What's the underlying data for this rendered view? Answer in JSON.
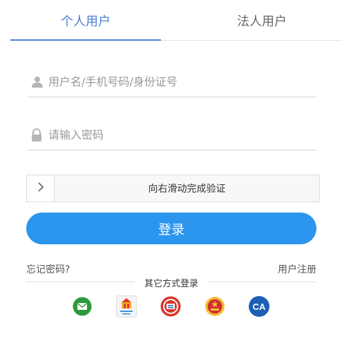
{
  "tabs": [
    {
      "label": "个人用户",
      "active": true
    },
    {
      "label": "法人用户",
      "active": false
    }
  ],
  "form": {
    "username_placeholder": "用户名/手机号码/身份证号",
    "password_placeholder": "请输入密码",
    "slider_text": "向右滑动完成验证",
    "login_label": "登录"
  },
  "links": {
    "forgot": "忘记密码?",
    "register": "用户注册"
  },
  "other_login": {
    "title": "其它方式登录",
    "icons": [
      "message-icon",
      "city-app-icon",
      "badge-icon",
      "national-emblem-icon",
      "ca-icon"
    ],
    "ca_label": "CA"
  },
  "colors": {
    "accent": "#4a7fd4",
    "login_button": "#2c95ee",
    "message_green": "#2a9a3b",
    "ca_blue": "#1c5fb4"
  }
}
